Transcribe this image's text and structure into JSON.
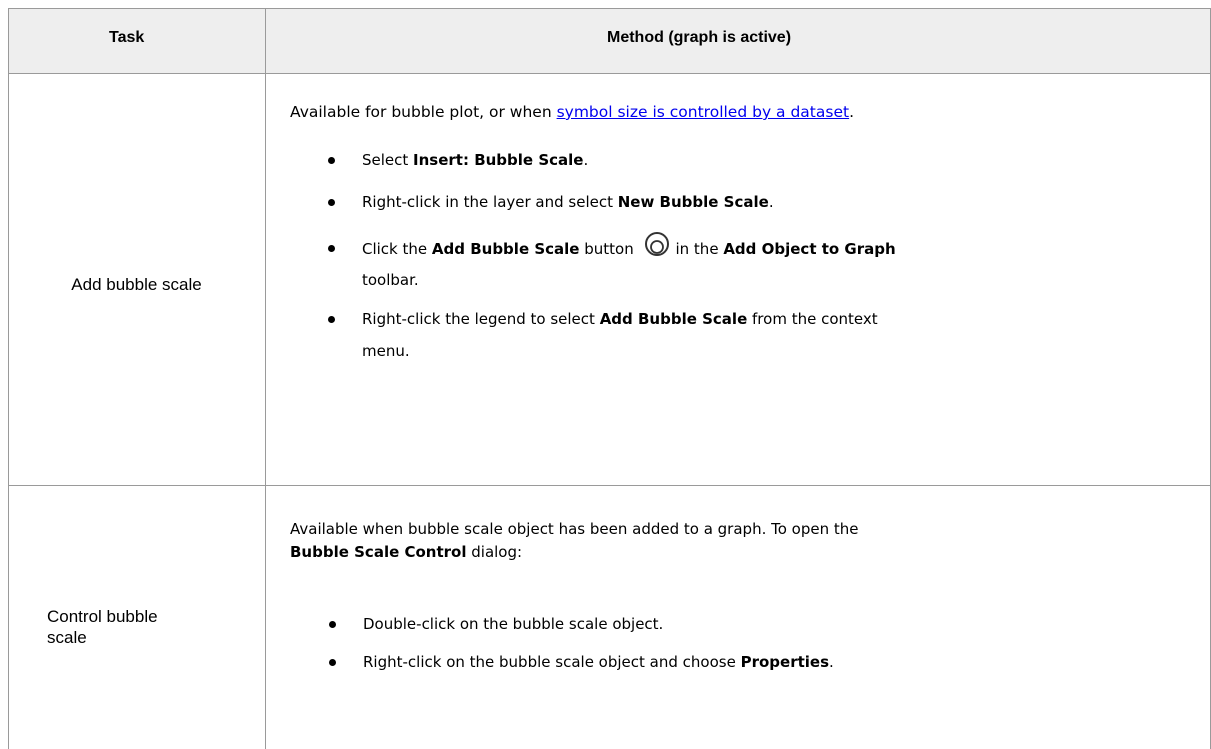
{
  "header": {
    "task": "Task",
    "method": "Method (graph is active)"
  },
  "rows": [
    {
      "task": "Add bubble scale",
      "intro_prefix": "Available for bubble plot, or when ",
      "intro_link": "symbol size is controlled by a dataset",
      "intro_suffix": ".",
      "bullets": [
        {
          "pre": "Select ",
          "bold": "Insert: Bubble Scale",
          "post": "."
        },
        {
          "pre": "Right-click in the layer and select ",
          "bold": "New Bubble Scale",
          "post": "."
        },
        {
          "pre": "Click the ",
          "bold": "Add Bubble Scale",
          "mid": " button ",
          "after_icon": "in the ",
          "bold2": "Add Object to Graph",
          "line2": "toolbar."
        },
        {
          "pre": "Right-click the legend to select ",
          "bold": "Add Bubble Scale",
          "post": " from the context",
          "line2": "menu."
        }
      ]
    },
    {
      "task_line1": "Control bubble",
      "task_line2": "scale",
      "intro_line1": "Available when bubble scale object has been added to a graph. To open the",
      "intro_bold": "Bubble Scale Control",
      "intro_post": " dialog:",
      "bullets": [
        {
          "text": "Double-click on the bubble scale object."
        },
        {
          "pre": "Right-click on the bubble scale object and choose ",
          "bold": "Properties",
          "post": "."
        }
      ]
    }
  ],
  "icons": {
    "bubble_scale": "bubble-scale-icon"
  }
}
